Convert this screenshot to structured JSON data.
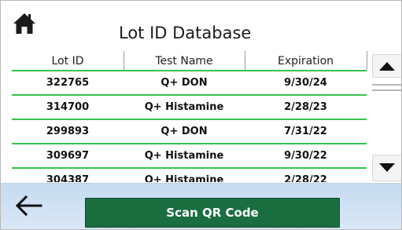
{
  "header": {
    "title": "Lot ID Database",
    "home_icon": "home-icon"
  },
  "table": {
    "columns": [
      "Lot ID",
      "Test Name",
      "Expiration"
    ],
    "rows": [
      {
        "lot_id": "322765",
        "test_name": "Q+ DON",
        "expiration": "9/30/24"
      },
      {
        "lot_id": "314700",
        "test_name": "Q+ Histamine",
        "expiration": "2/28/23"
      },
      {
        "lot_id": "299893",
        "test_name": "Q+ DON",
        "expiration": "7/31/22"
      },
      {
        "lot_id": "309697",
        "test_name": "Q+ Histamine",
        "expiration": "9/30/22"
      },
      {
        "lot_id": "304387",
        "test_name": "Q+ Histamine",
        "expiration": "2/28/22"
      }
    ],
    "row_separator_color": "#36c24c"
  },
  "scrollbar": {
    "up_icon": "triangle-up-icon",
    "down_icon": "triangle-down-icon"
  },
  "footer": {
    "back_icon": "arrow-left-icon",
    "scan_button_label": "Scan QR Code",
    "scan_button_color": "#1a6e40",
    "bar_color": "#cfe1f4"
  }
}
